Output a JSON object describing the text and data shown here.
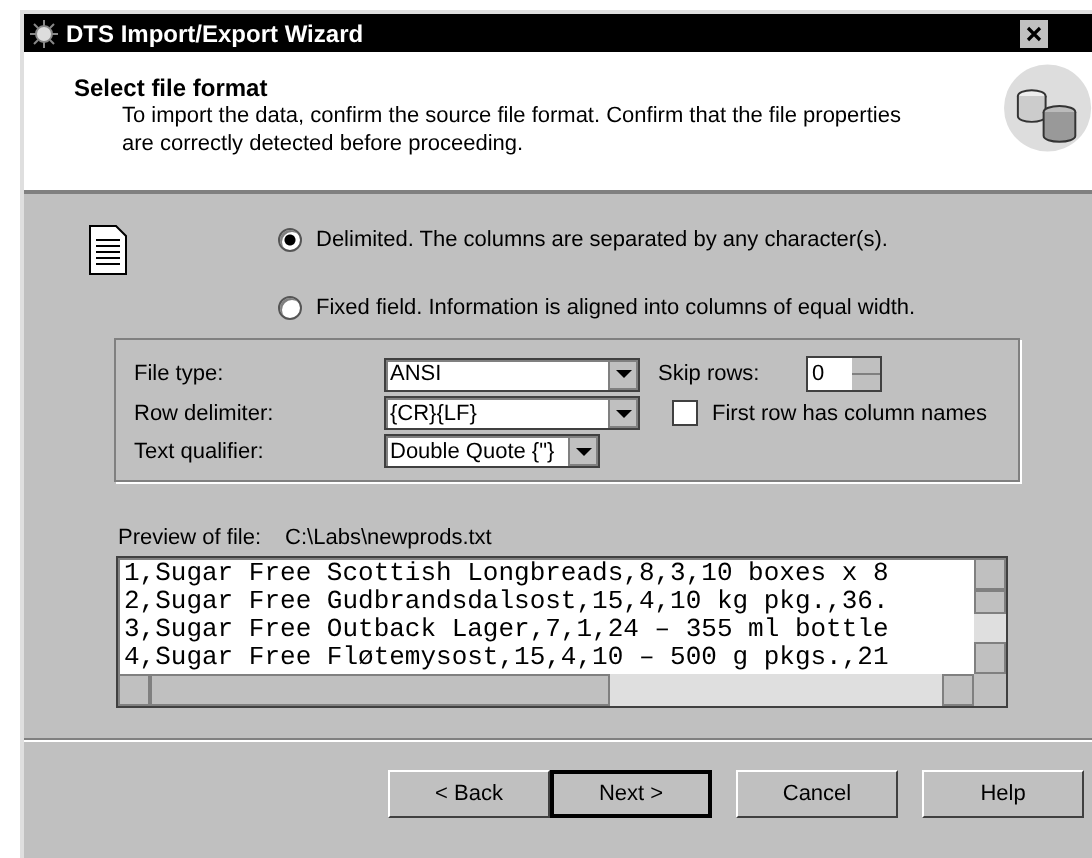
{
  "window": {
    "title": "DTS Import/Export Wizard"
  },
  "header": {
    "title": "Select file format",
    "description": "To import the data, confirm the source file format.  Confirm that the file properties are correctly detected before proceeding."
  },
  "format_options": [
    {
      "label": "Delimited.  The columns are separated by any character(s).",
      "selected": true
    },
    {
      "label": "Fixed field.  Information is aligned into columns of equal width.",
      "selected": false
    }
  ],
  "file_type": {
    "label": "File type:",
    "value": "ANSI"
  },
  "row_delimiter": {
    "label": "Row delimiter:",
    "value": "{CR}{LF}"
  },
  "text_qualifier": {
    "label": "Text qualifier:",
    "value": "Double Quote {\"}"
  },
  "skip_rows": {
    "label": "Skip rows:",
    "value": "0"
  },
  "first_row_names": {
    "label": "First row has column names",
    "checked": false
  },
  "preview": {
    "label": "Preview of file:",
    "path": "C:\\Labs\\newprods.txt",
    "lines": [
      "1,Sugar Free Scottish Longbreads,8,3,10 boxes x 8",
      "2,Sugar Free Gudbrandsdalsost,15,4,10 kg pkg.,36.",
      "3,Sugar Free Outback Lager,7,1,24 – 355 ml bottle",
      "4,Sugar Free Fløtemysost,15,4,10 – 500 g pkgs.,21"
    ]
  },
  "buttons": [
    {
      "label": "< Back",
      "kind": "normal"
    },
    {
      "label": "Next >",
      "kind": "default"
    },
    {
      "label": "Cancel",
      "kind": "normal"
    },
    {
      "label": "Help",
      "kind": "normal"
    }
  ]
}
